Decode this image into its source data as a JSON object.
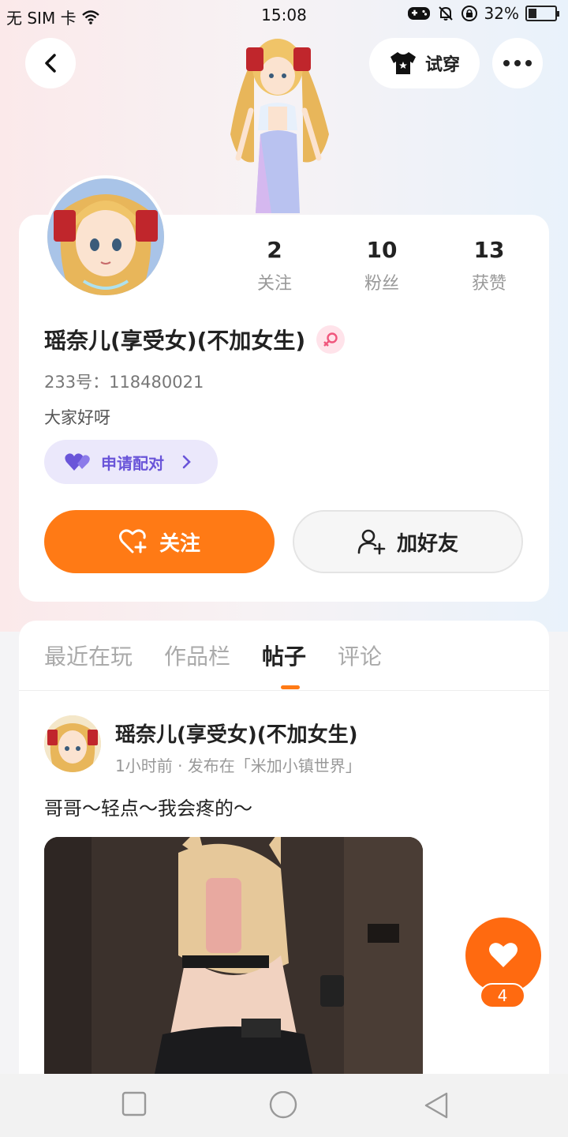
{
  "status_bar": {
    "carrier": "无 SIM 卡",
    "time": "15:08",
    "battery": "32%",
    "battery_level": 0.32
  },
  "header": {
    "try_on_label": "试穿"
  },
  "profile": {
    "stats": [
      {
        "value": "2",
        "label": "关注"
      },
      {
        "value": "10",
        "label": "粉丝"
      },
      {
        "value": "13",
        "label": "获赞"
      }
    ],
    "username": "瑶奈儿(享受女)(不加女生)",
    "user_id": "233号：118480021",
    "bio": "大家好呀",
    "pair_label": "申请配对",
    "follow_label": "关注",
    "add_friend_label": "加好友"
  },
  "tabs": [
    {
      "label": "最近在玩",
      "active": false
    },
    {
      "label": "作品栏",
      "active": false
    },
    {
      "label": "帖子",
      "active": true
    },
    {
      "label": "评论",
      "active": false
    }
  ],
  "post": {
    "author": "瑶奈儿(享受女)(不加女生)",
    "meta": "1小时前 · 发布在「米加小镇世界」",
    "text": "哥哥～轻点～我会疼的～"
  },
  "like": {
    "count": "4"
  },
  "colors": {
    "accent": "#ff7a15",
    "pair_bg": "#ebe8fb",
    "pair_text": "#6a55d9"
  }
}
